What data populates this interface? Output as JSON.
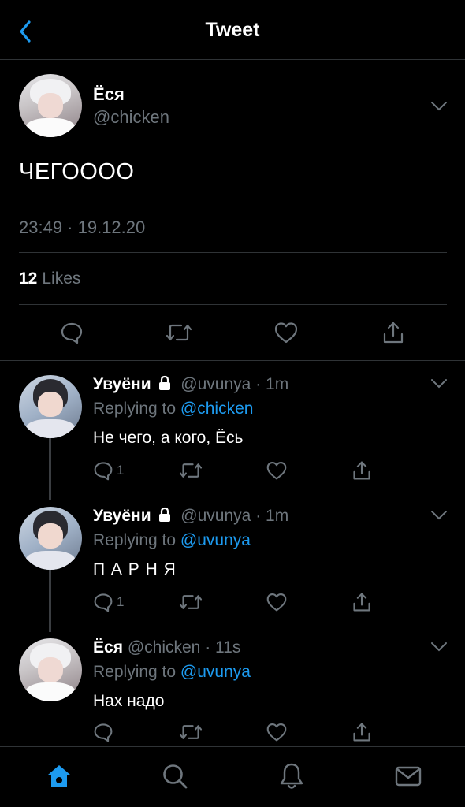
{
  "header": {
    "title": "Tweet"
  },
  "main_tweet": {
    "name": "Ёся",
    "handle": "@chicken",
    "text": "ЧЕГОООО",
    "timestamp": "23:49 · 19.12.20",
    "likes_count": "12",
    "likes_label": "Likes"
  },
  "replies": [
    {
      "name": "Увуёни",
      "handle": "@uvunya",
      "sep": "·",
      "time": "1m",
      "replying_prefix": "Replying to",
      "replying_to": "@chicken",
      "text": "Не чего, а кого, Ёсь",
      "reply_count": "1",
      "locked": true
    },
    {
      "name": "Увуёни",
      "handle": "@uvunya",
      "sep": "·",
      "time": "1m",
      "replying_prefix": "Replying to",
      "replying_to": "@uvunya",
      "text": "П А Р Н Я",
      "reply_count": "1",
      "locked": true
    },
    {
      "name": "Ёся",
      "handle": "@chicken",
      "sep": "·",
      "time": "11s",
      "replying_prefix": "Replying to",
      "replying_to": "@uvunya",
      "text": "Нах надо",
      "reply_count": "",
      "locked": false
    }
  ],
  "icons": {
    "back": "chevron-left-icon",
    "more": "chevron-down-icon",
    "reply": "comment-icon",
    "retweet": "retweet-icon",
    "like": "heart-icon",
    "share": "share-icon",
    "lock": "lock-icon",
    "tabs": [
      "home-icon",
      "search-icon",
      "bell-icon",
      "mail-icon"
    ]
  },
  "colors": {
    "accent": "#1d9bf0",
    "muted": "#6e767d",
    "background": "#000000",
    "divider": "#2f3336"
  }
}
